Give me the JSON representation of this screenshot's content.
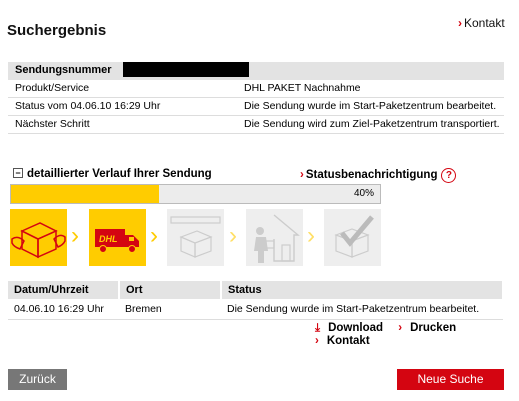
{
  "header": {
    "title": "Suchergebnis",
    "kontakt_label": "Kontakt"
  },
  "shipment": {
    "number_label": "Sendungsnummer",
    "rows": [
      {
        "key": "Produkt/Service",
        "value": "DHL PAKET Nachnahme"
      },
      {
        "key": "Status vom 04.06.10 16:29 Uhr",
        "value": "Die Sendung wurde im Start-Paketzentrum bearbeitet."
      },
      {
        "key": "Nächster Schritt",
        "value": "Die Sendung wird zum Ziel-Paketzentrum transportiert."
      }
    ]
  },
  "tracking": {
    "toggle_label": "detaillierter Verlauf Ihrer Sendung",
    "toggle_symbol": "−",
    "notification_label": "Statusbenachrichtigung",
    "help_symbol": "?",
    "progress_percent": 40,
    "progress_text": "40%",
    "steps": [
      {
        "icon": "package-handover-icon",
        "active": true
      },
      {
        "icon": "dhl-truck-icon",
        "active": true
      },
      {
        "icon": "package-center-icon",
        "active": false
      },
      {
        "icon": "delivery-house-icon",
        "active": false
      },
      {
        "icon": "delivered-check-icon",
        "active": false
      }
    ]
  },
  "history": {
    "columns": [
      "Datum/Uhrzeit",
      "Ort",
      "Status"
    ],
    "rows": [
      {
        "date": "04.06.10 16:29 Uhr",
        "place": "Bremen",
        "status": "Die Sendung wurde im Start-Paketzentrum bearbeitet."
      }
    ]
  },
  "actions": {
    "download": "Download",
    "print": "Drucken",
    "contact": "Kontakt"
  },
  "buttons": {
    "back": "Zurück",
    "new_search": "Neue Suche"
  },
  "colors": {
    "accent": "#d40511",
    "yellow": "#ffcc00"
  }
}
